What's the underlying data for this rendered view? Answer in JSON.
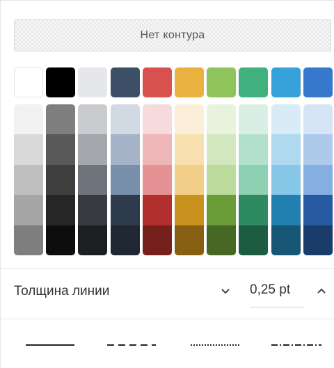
{
  "no_outline_label": "Нет контура",
  "palette": {
    "columns": [
      {
        "name": "white",
        "main": "#ffffff",
        "shades": [
          "#f2f2f2",
          "#d9d9d9",
          "#bfbfbf",
          "#a6a6a6",
          "#7f7f7f"
        ]
      },
      {
        "name": "black",
        "main": "#000000",
        "shades": [
          "#7f7f7f",
          "#595959",
          "#3f3f3f",
          "#262626",
          "#0d0d0d"
        ]
      },
      {
        "name": "light-gray",
        "main": "#e5e7ea",
        "shades": [
          "#c9cbce",
          "#a4a8ad",
          "#6e747b",
          "#373b40",
          "#1c1e21"
        ]
      },
      {
        "name": "dark-blue",
        "main": "#3d4f66",
        "shades": [
          "#d1d9e3",
          "#a4b3c8",
          "#7890ac",
          "#2e3b4d",
          "#1f2733"
        ]
      },
      {
        "name": "red",
        "main": "#d7524f",
        "shades": [
          "#f7dadb",
          "#efb6b7",
          "#e69193",
          "#b1302d",
          "#76201e"
        ]
      },
      {
        "name": "orange",
        "main": "#e9b13f",
        "shades": [
          "#fbefd9",
          "#f7dfb0",
          "#f2cf88",
          "#c9921e",
          "#875f12"
        ]
      },
      {
        "name": "green",
        "main": "#8fc35c",
        "shades": [
          "#e8f3de",
          "#d2e7bd",
          "#bbdb9c",
          "#6a9c38",
          "#476825"
        ]
      },
      {
        "name": "teal",
        "main": "#40b07f",
        "shades": [
          "#d9efe5",
          "#b3e0cc",
          "#8dd0b2",
          "#2d8a61",
          "#1e5c41"
        ]
      },
      {
        "name": "light-blue",
        "main": "#37a2d9",
        "shades": [
          "#d7ecf7",
          "#afd9ef",
          "#87c7e8",
          "#2280b0",
          "#175675"
        ]
      },
      {
        "name": "blue",
        "main": "#3578cc",
        "shades": [
          "#d7e4f5",
          "#aecaeb",
          "#86afe1",
          "#265aa0",
          "#1a3c6b"
        ]
      }
    ]
  },
  "line_thickness": {
    "label": "Толщина линии",
    "value": "0,25 pt"
  },
  "line_styles": [
    "solid",
    "dashed",
    "dotted",
    "dash-dot"
  ],
  "colors": {
    "text": "#333333",
    "divider": "#e3e3e3"
  }
}
